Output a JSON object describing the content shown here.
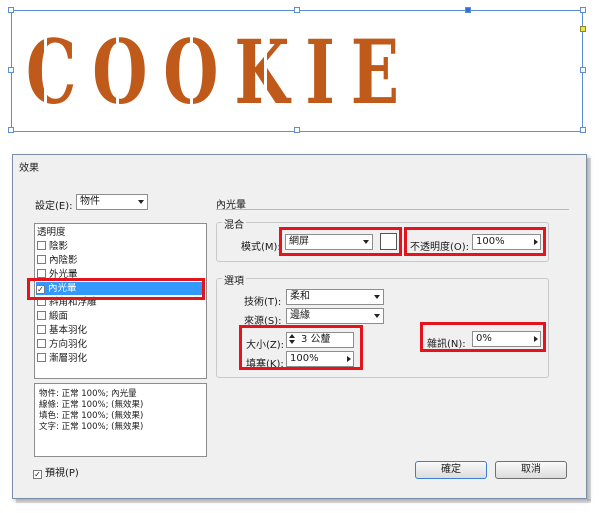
{
  "canvas": {
    "artwork_text": "COOKIE",
    "artwork_color": "#c05a1a",
    "selection_color": "#5b8fd6"
  },
  "dialog": {
    "title": "效果",
    "settings_label": "設定(E):",
    "settings_value": "物件",
    "list_items": [
      {
        "label": "透明度",
        "has_checkbox": false,
        "checked": false
      },
      {
        "label": "陰影",
        "has_checkbox": true,
        "checked": false
      },
      {
        "label": "內陰影",
        "has_checkbox": true,
        "checked": false
      },
      {
        "label": "外光暈",
        "has_checkbox": true,
        "checked": false
      },
      {
        "label": "內光暈",
        "has_checkbox": true,
        "checked": true
      },
      {
        "label": "斜角和浮雕",
        "has_checkbox": true,
        "checked": false
      },
      {
        "label": "緞面",
        "has_checkbox": true,
        "checked": false
      },
      {
        "label": "基本羽化",
        "has_checkbox": true,
        "checked": false
      },
      {
        "label": "方向羽化",
        "has_checkbox": true,
        "checked": false
      },
      {
        "label": "漸層羽化",
        "has_checkbox": true,
        "checked": false
      }
    ],
    "summary_lines": [
      "物件: 正常 100%; 內光暈",
      "線條: 正常 100%; (無效果)",
      "填色: 正常 100%; (無效果)",
      "文字: 正常 100%; (無效果)"
    ],
    "section_title": "內光暈",
    "blend": {
      "group_title": "混合",
      "mode_label": "模式(M):",
      "mode_value": "網屏",
      "swatch_color": "#ffffff",
      "opacity_label": "不透明度(O):",
      "opacity_value": "100%"
    },
    "options": {
      "group_title": "選項",
      "technique_label": "技術(T):",
      "technique_value": "柔和",
      "source_label": "來源(S):",
      "source_value": "邊緣",
      "size_label": "大小(Z):",
      "size_value": "3 公釐",
      "choke_label": "填塞(K):",
      "choke_value": "100%",
      "noise_label": "雜訊(N):",
      "noise_value": "0%"
    },
    "preview_label": "預視(P)",
    "preview_checked": true,
    "ok_label": "確定",
    "cancel_label": "取消",
    "highlight_color": "#e3141b",
    "list_selected_color": "#3399ff"
  }
}
